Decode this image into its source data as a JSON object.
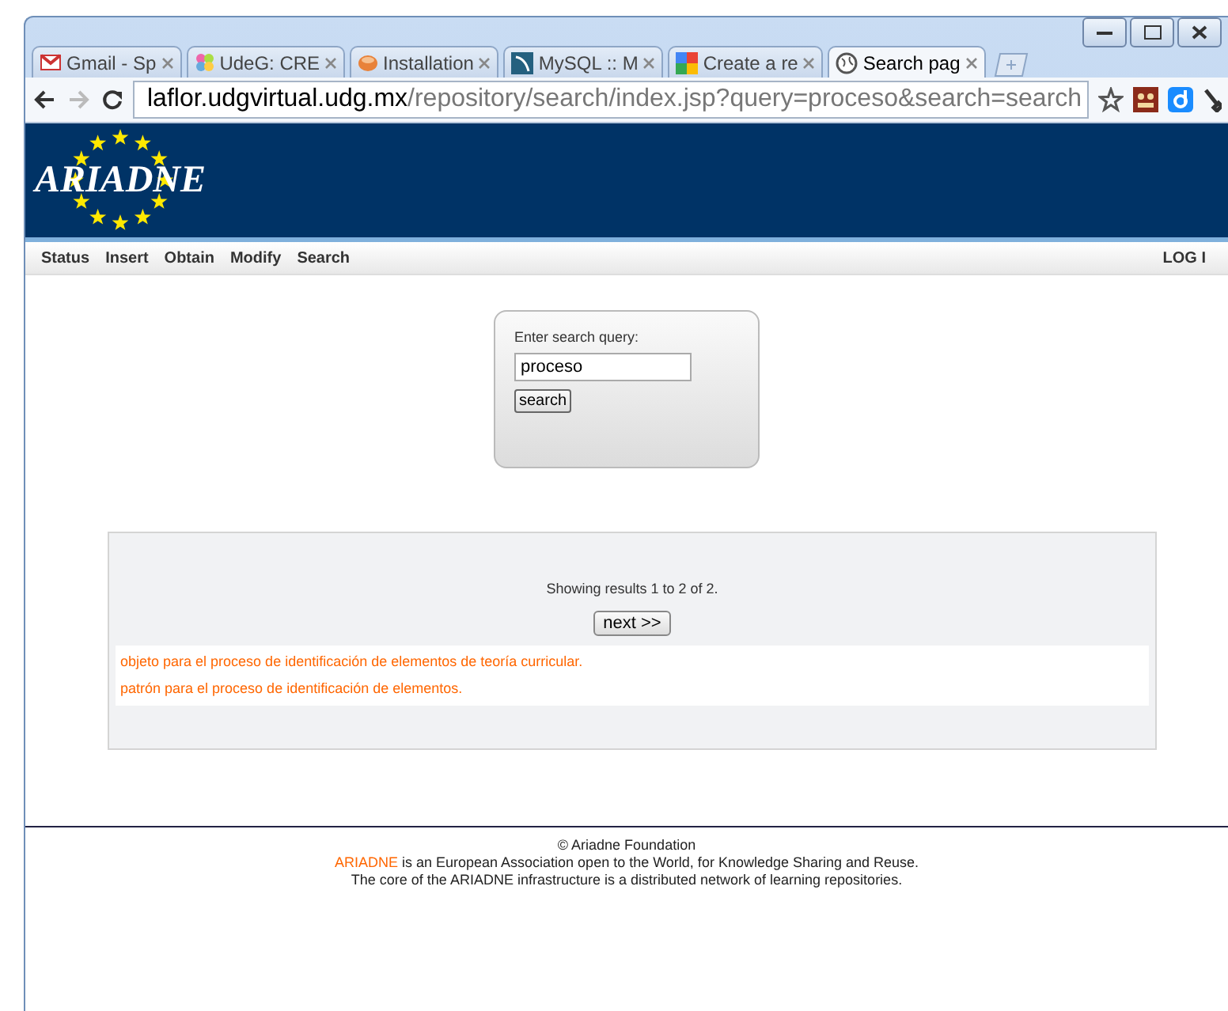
{
  "browser": {
    "tabs": [
      {
        "label": "Gmail - Sp",
        "selected": false
      },
      {
        "label": "UdeG: CRE",
        "selected": false
      },
      {
        "label": "Installation",
        "selected": false
      },
      {
        "label": "MySQL :: M",
        "selected": false
      },
      {
        "label": "Create a re",
        "selected": false
      },
      {
        "label": "Search pag",
        "selected": true
      }
    ],
    "url_host": "laflor.udgvirtual.udg.mx",
    "url_path": "/repository/search/index.jsp?query=proceso&search=search"
  },
  "header": {
    "logo": "ARIADNE"
  },
  "nav": {
    "items": [
      "Status",
      "Insert",
      "Obtain",
      "Modify",
      "Search"
    ],
    "login": "LOG I"
  },
  "search": {
    "label": "Enter search query:",
    "value": "proceso",
    "button": "search"
  },
  "results": {
    "summary": "Showing results 1 to 2 of 2.",
    "next": "next >>",
    "items": [
      "objeto para el proceso de identificación de elementos de teoría curricular.",
      "patrón para el proceso de identificación de elementos."
    ]
  },
  "footer": {
    "copyright": "© Ariadne Foundation",
    "link": "ARIADNE",
    "line1": " is an European Association open to the World, for Knowledge Sharing and Reuse.",
    "line2": "The core of the ARIADNE infrastructure is a distributed network of learning repositories."
  }
}
